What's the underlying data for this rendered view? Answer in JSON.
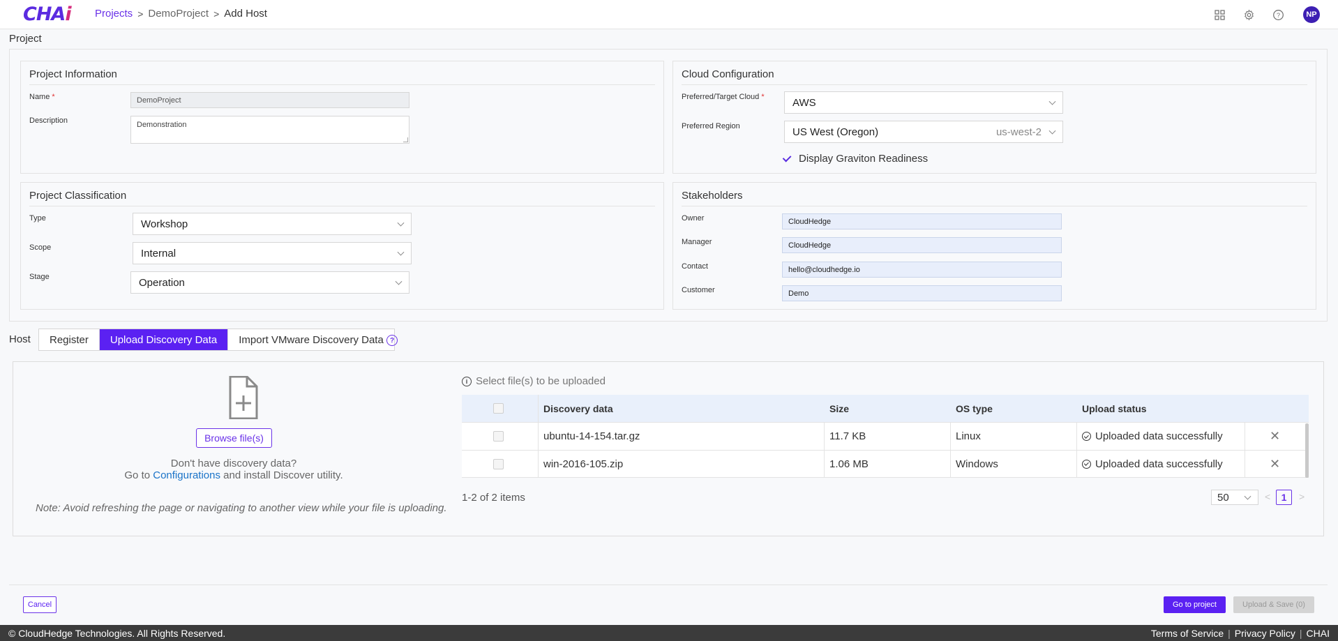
{
  "header": {
    "logo": {
      "main": "CHA",
      "accent": "i"
    },
    "breadcrumb": [
      "Projects",
      "DemoProject",
      "Add Host"
    ],
    "breadcrumb_separator": ">",
    "avatar_initials": "NP",
    "icons": [
      "grid-icon",
      "gear-icon",
      "help-icon"
    ]
  },
  "page": {
    "section_title": "Project"
  },
  "project_info": {
    "title": "Project Information",
    "name_label": "Name",
    "name_required": "*",
    "name_value": "DemoProject",
    "description_label": "Description",
    "description_value": "Demonstration"
  },
  "cloud_config": {
    "title": "Cloud Configuration",
    "target_cloud_label": "Preferred/Target Cloud",
    "target_cloud_required": "*",
    "target_cloud_value": "AWS",
    "region_label": "Preferred Region",
    "region_value": "US West (Oregon)",
    "region_code": "us-west-2",
    "graviton_label": "Display Graviton Readiness"
  },
  "classification": {
    "title": "Project Classification",
    "type_label": "Type",
    "type_value": "Workshop",
    "scope_label": "Scope",
    "scope_value": "Internal",
    "stage_label": "Stage",
    "stage_value": "Operation"
  },
  "stakeholders": {
    "title": "Stakeholders",
    "owner_label": "Owner",
    "owner_value": "CloudHedge",
    "manager_label": "Manager",
    "manager_value": "CloudHedge",
    "contact_label": "Contact",
    "contact_value": "hello@cloudhedge.io",
    "customer_label": "Customer",
    "customer_value": "Demo"
  },
  "host": {
    "label": "Host",
    "tabs": [
      "Register",
      "Upload Discovery Data",
      "Import VMware Discovery Data"
    ],
    "active_tab": "Upload Discovery Data",
    "help_glyph": "?"
  },
  "upload": {
    "browse_label": "Browse file(s)",
    "no_data_line1": "Don't have discovery data?",
    "no_data_prefix": "Go to",
    "no_data_link": "Configurations",
    "no_data_suffix": "and install Discover utility.",
    "note": "Note: Avoid refreshing the page or navigating to another view while your file is uploading.",
    "select_hint": "Select file(s) to be uploaded",
    "columns": [
      "Discovery data",
      "Size",
      "OS type",
      "Upload status"
    ],
    "rows": [
      {
        "file": "ubuntu-14-154.tar.gz",
        "size": "11.7 KB",
        "os": "Linux",
        "status": "Uploaded data successfully"
      },
      {
        "file": "win-2016-105.zip",
        "size": "1.06 MB",
        "os": "Windows",
        "status": "Uploaded data successfully"
      }
    ],
    "count_text": "1-2 of 2 items",
    "page_size": "50",
    "current_page": "1",
    "prev_glyph": "<",
    "next_glyph": ">"
  },
  "actions": {
    "cancel": "Cancel",
    "go_to_project": "Go to project",
    "upload_save": "Upload & Save (0)"
  },
  "footer": {
    "copyright": "© CloudHedge Technologies. All Rights Reserved.",
    "links": [
      "Terms of Service",
      "Privacy Policy",
      "CHAI"
    ],
    "separator": "|"
  },
  "colors": {
    "accent": "#5b21f2",
    "link": "#1a73c8",
    "footer_bg": "#3b3b3b"
  }
}
